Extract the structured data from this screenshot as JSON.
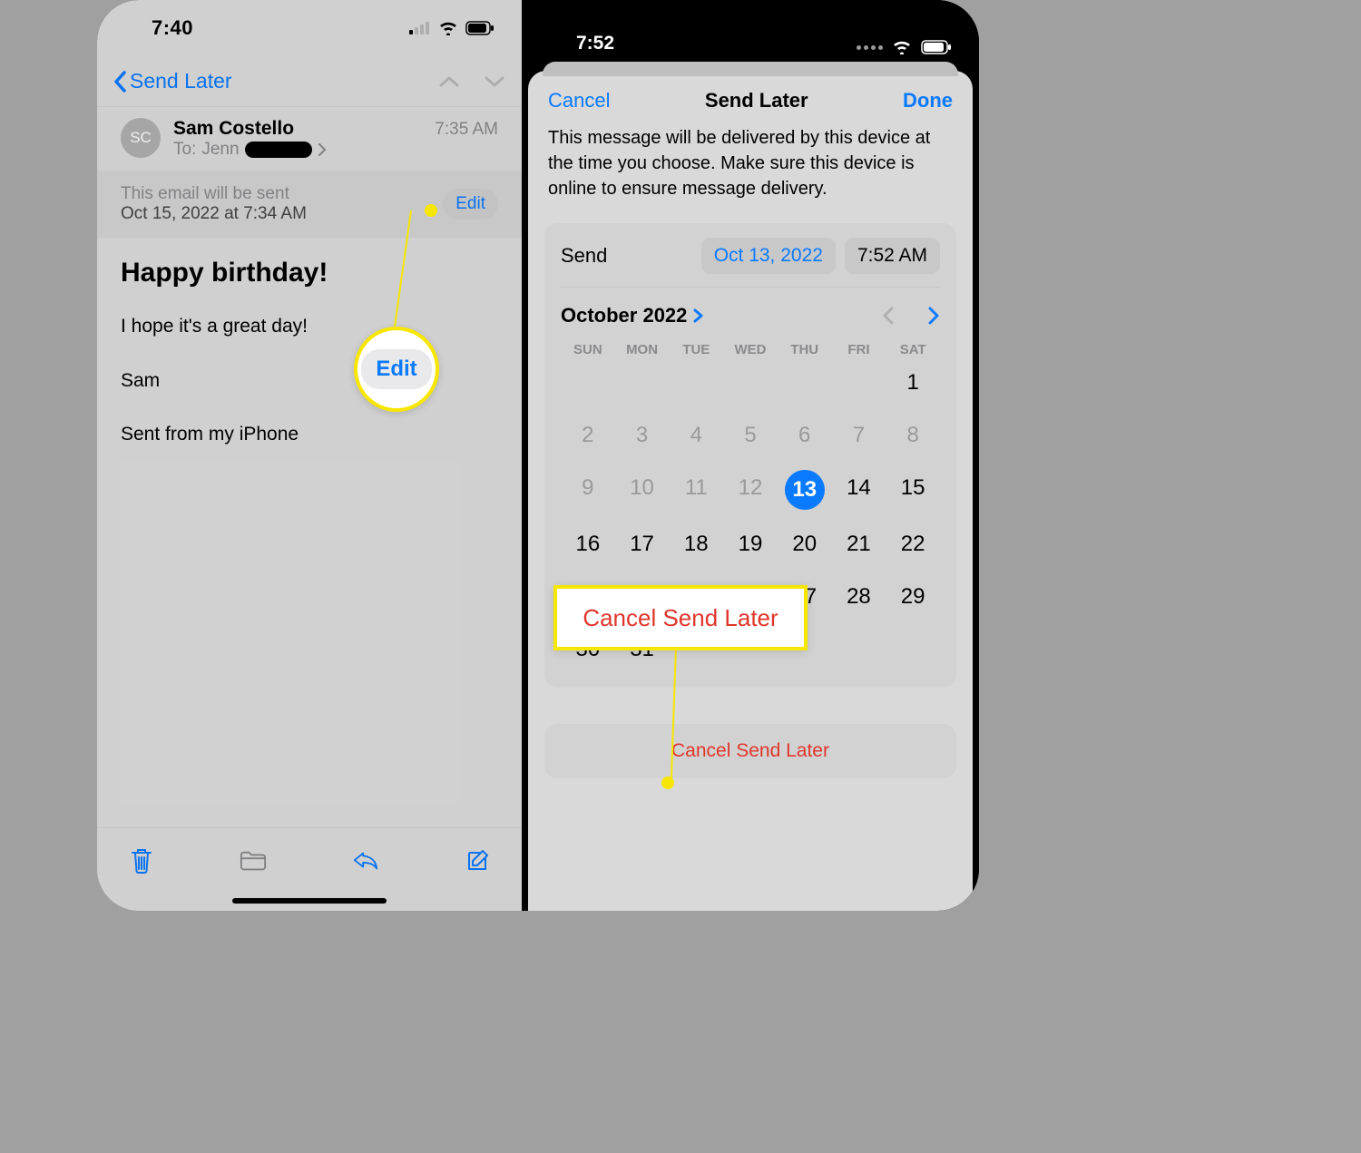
{
  "left": {
    "status_time": "7:40",
    "nav_back": "Send Later",
    "header": {
      "avatar": "SC",
      "sender": "Sam Costello",
      "to_label": "To:",
      "to_name": "Jenn",
      "received_time": "7:35 AM"
    },
    "schedule": {
      "line1": "This email will be sent",
      "line2": "Oct 15, 2022 at 7:34 AM",
      "edit": "Edit"
    },
    "subject": "Happy birthday!",
    "body_line1": "I hope it's a great day!",
    "body_signoff": "Sam",
    "body_signature": "Sent from my iPhone",
    "callout_edit": "Edit"
  },
  "right": {
    "status_time": "7:52",
    "sheet": {
      "cancel": "Cancel",
      "title": "Send Later",
      "done": "Done",
      "note": "This message will be delivered by this device at the time you choose. Make sure this device is online to ensure message delivery.",
      "send_label": "Send",
      "send_date": "Oct 13, 2022",
      "send_time": "7:52 AM",
      "month": "October 2022",
      "dow": [
        "SUN",
        "MON",
        "TUE",
        "WED",
        "THU",
        "FRI",
        "SAT"
      ],
      "cancel_send": "Cancel Send Later"
    },
    "callout_cancel": "Cancel Send Later"
  },
  "calendar": {
    "blanks": 6,
    "days": 31,
    "selected": 13,
    "future_from": 14
  }
}
